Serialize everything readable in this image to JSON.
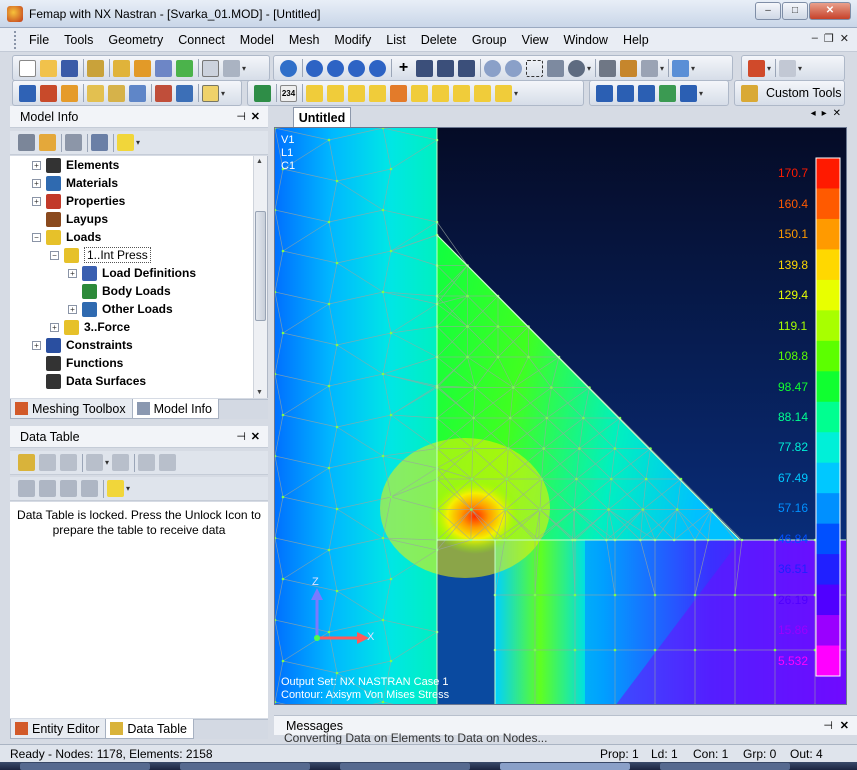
{
  "window": {
    "title": "Femap with NX Nastran - [Svarka_01.MOD] - [Untitled]",
    "minimize": "–",
    "maximize": "□",
    "close": "✕"
  },
  "menu": [
    "File",
    "Tools",
    "Geometry",
    "Connect",
    "Model",
    "Mesh",
    "Modify",
    "List",
    "Delete",
    "Group",
    "View",
    "Window",
    "Help"
  ],
  "mdi_controls": {
    "minimize": "–",
    "restore": "❐",
    "close": "✕"
  },
  "toolbar": {
    "custom_tools_label": "Custom Tools"
  },
  "model_info": {
    "title": "Model Info",
    "tree": [
      {
        "label": "Elements",
        "icon": "elements-icon",
        "indent": 1,
        "expander": "+"
      },
      {
        "label": "Materials",
        "icon": "materials-icon",
        "indent": 1,
        "expander": "+"
      },
      {
        "label": "Properties",
        "icon": "properties-icon",
        "indent": 1,
        "expander": "+"
      },
      {
        "label": "Layups",
        "icon": "layups-icon",
        "indent": 1,
        "expander": ""
      },
      {
        "label": "Loads",
        "icon": "loads-icon",
        "indent": 1,
        "expander": "−"
      },
      {
        "label": "1..Int Press",
        "icon": "load-set-icon",
        "indent": 2,
        "expander": "−",
        "selected": true
      },
      {
        "label": "Load Definitions",
        "icon": "load-definitions-icon",
        "indent": 3,
        "expander": "+"
      },
      {
        "label": "Body Loads",
        "icon": "body-loads-icon",
        "indent": 3,
        "expander": ""
      },
      {
        "label": "Other Loads",
        "icon": "other-loads-icon",
        "indent": 3,
        "expander": "+"
      },
      {
        "label": "3..Force",
        "icon": "load-set-icon",
        "indent": 2,
        "expander": "+"
      },
      {
        "label": "Constraints",
        "icon": "constraints-icon",
        "indent": 1,
        "expander": "+"
      },
      {
        "label": "Functions",
        "icon": "functions-icon",
        "indent": 1,
        "expander": ""
      },
      {
        "label": "Data Surfaces",
        "icon": "data-surfaces-icon",
        "indent": 1,
        "expander": ""
      }
    ],
    "tabs": [
      "Meshing Toolbox",
      "Model Info"
    ]
  },
  "data_table": {
    "title": "Data Table",
    "message": "Data Table is locked. Press the Unlock Icon to prepare the table to receive data",
    "tabs": [
      "Entity Editor",
      "Data Table"
    ]
  },
  "viewport": {
    "tab_label": "Untitled",
    "view_info": [
      "V1",
      "L1",
      "C1"
    ],
    "output_set": "Output Set: NX NASTRAN Case 1",
    "contour": "Contour: Axisym Von Mises Stress",
    "axis_z": "Z",
    "axis_x": "X",
    "legend_values": [
      "170.7",
      "160.4",
      "150.1",
      "139.8",
      "129.4",
      "119.1",
      "108.8",
      "98.47",
      "88.14",
      "77.82",
      "67.49",
      "57.16",
      "46.84",
      "36.51",
      "26.19",
      "15.86",
      "5.532"
    ],
    "legend_colors": [
      "#ff1a00",
      "#ff5a00",
      "#ff9a00",
      "#ffd800",
      "#e8ff00",
      "#a8ff00",
      "#5cff00",
      "#10ff30",
      "#00ff90",
      "#00f0d8",
      "#00c8ff",
      "#0090ff",
      "#0050ff",
      "#2020ff",
      "#5000ff",
      "#9a00ff",
      "#ff00ff"
    ]
  },
  "messages": {
    "title": "Messages",
    "last_line": "Converting Data on Elements to Data on Nodes..."
  },
  "status": {
    "text": "Ready - Nodes: 1178,  Elements: 2158",
    "prop": "Prop: 1",
    "ld": "Ld: 1",
    "con": "Con: 1",
    "grp": "Grp: 0",
    "out": "Out: 4"
  }
}
